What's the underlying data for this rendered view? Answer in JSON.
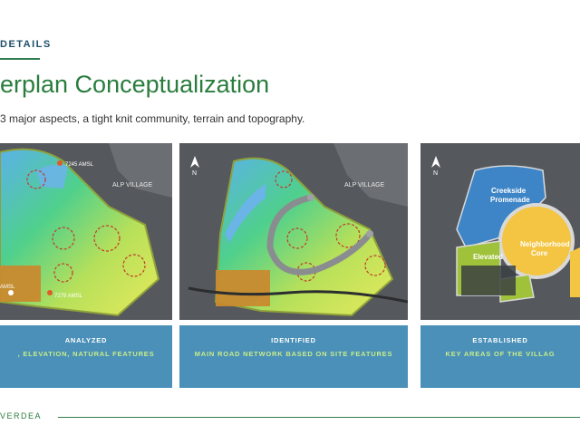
{
  "header": {
    "section_tag": "DETAILS",
    "title": "erplan Conceptualization",
    "subtitle": "3 major aspects, a tight knit community, terrain and topography."
  },
  "panels": [
    {
      "caption_head": "ANALYZED",
      "caption_sub": ", ELEVATION, NATURAL FEATURES",
      "labels": {
        "village": "ALP VILLAGE",
        "amsl_top": "7245 AMSL",
        "amsl_bottom": "7279 AMSL",
        "amsl_left": "AMSL"
      }
    },
    {
      "caption_head": "IDENTIFIED",
      "caption_sub": "MAIN ROAD NETWORK BASED ON SITE FEATURES",
      "labels": {
        "village": "ALP VILLAGE",
        "north": "N"
      }
    },
    {
      "caption_head": "ESTABLISHED",
      "caption_sub": "KEY AREAS OF THE VILLAG",
      "labels": {
        "north": "N",
        "zone_promenade_1": "Creekside",
        "zone_promenade_2": "Promenade",
        "zone_core_1": "Neighborhood",
        "zone_core_2": "Core",
        "zone_elevated": "Elevated"
      }
    }
  ],
  "footer": {
    "brand": "VERDEA"
  },
  "colors": {
    "title_green": "#2a7d3e",
    "caption_blue": "#4a90b8",
    "caption_sub_green": "#c8ec8a",
    "zone_blue": "#3d85c6",
    "zone_yellow": "#f4c542",
    "zone_green": "#9fc23a"
  }
}
